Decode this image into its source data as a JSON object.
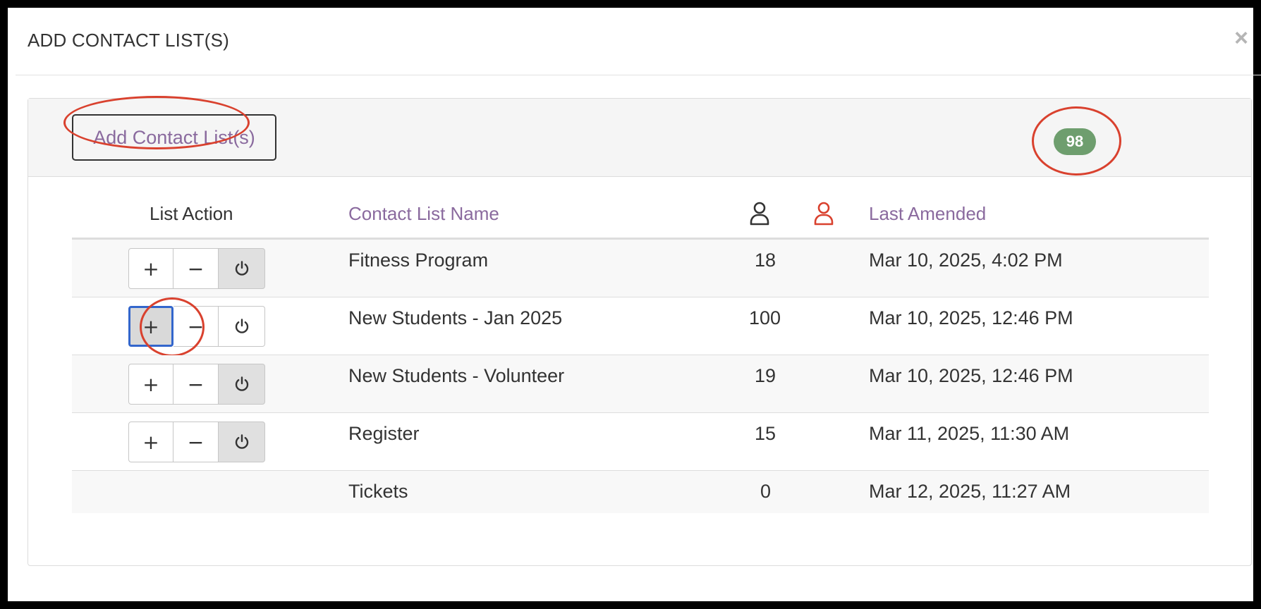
{
  "modal": {
    "title": "ADD CONTACT LIST(S)",
    "close_glyph": "×"
  },
  "toolbar": {
    "add_label": "Add Contact List(s)",
    "count": "98"
  },
  "table": {
    "headers": {
      "action": "List Action",
      "name": "Contact List Name",
      "amended": "Last Amended"
    },
    "icons": {
      "contacts": "person-icon",
      "unsubscribed": "person-red-icon"
    },
    "colors": {
      "link": "#8a6a9e",
      "badge": "#6e9e6e",
      "annotation": "#d9412e",
      "focus": "#3366cc"
    },
    "action_glyphs": {
      "add": "+",
      "remove": "−"
    },
    "rows": [
      {
        "name": "Fitness Program",
        "count": "18",
        "amended": "Mar 10, 2025, 4:02 PM"
      },
      {
        "name": "New Students - Jan 2025",
        "count": "100",
        "amended": "Mar 10, 2025, 12:46 PM"
      },
      {
        "name": "New Students - Volunteer",
        "count": "19",
        "amended": "Mar 10, 2025, 12:46 PM"
      },
      {
        "name": "Register",
        "count": "15",
        "amended": "Mar 11, 2025, 11:30 AM"
      },
      {
        "name": "Tickets",
        "count": "0",
        "amended": "Mar 12, 2025, 11:27 AM"
      }
    ]
  }
}
